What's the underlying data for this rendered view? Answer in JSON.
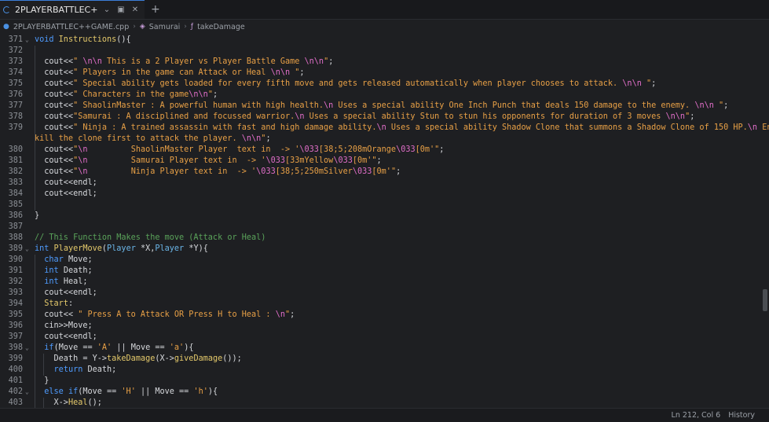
{
  "tab": {
    "title": "2PLAYERBATTLEC++GAM…"
  },
  "breadcrumb": {
    "file": "2PLAYERBATTLEC++GAME.cpp",
    "class": "Samurai",
    "method": "takeDamage"
  },
  "status": {
    "position": "Ln 212, Col 6",
    "history": "History"
  },
  "lines": [
    {
      "n": "371",
      "fold": true,
      "segs": [
        [
          "kw",
          "void "
        ],
        [
          "fn",
          "Instructions"
        ],
        [
          "pl",
          "(){"
        ]
      ]
    },
    {
      "n": "372",
      "segs": []
    },
    {
      "n": "373",
      "segs": [
        [
          "pl",
          "  cout<<"
        ],
        [
          "str",
          "\" "
        ],
        [
          "esc",
          "\\n\\n"
        ],
        [
          "str",
          " This is a 2 Player vs Player Battle Game "
        ],
        [
          "esc",
          "\\n\\n"
        ],
        [
          "str",
          "\""
        ],
        [
          "pl",
          ";"
        ]
      ]
    },
    {
      "n": "374",
      "segs": [
        [
          "pl",
          "  cout<<"
        ],
        [
          "str",
          "\" Players in the game can Attack or Heal "
        ],
        [
          "esc",
          "\\n\\n"
        ],
        [
          "str",
          " \""
        ],
        [
          "pl",
          ";"
        ]
      ]
    },
    {
      "n": "375",
      "segs": [
        [
          "pl",
          "  cout<<"
        ],
        [
          "str",
          "\" Special ability gets loaded for every fifth move and gets released automatically when player chooses to attack. "
        ],
        [
          "esc",
          "\\n\\n"
        ],
        [
          "str",
          " \""
        ],
        [
          "pl",
          ";"
        ]
      ]
    },
    {
      "n": "376",
      "segs": [
        [
          "pl",
          "  cout<<"
        ],
        [
          "str",
          "\" Characters in the game"
        ],
        [
          "esc",
          "\\n\\n"
        ],
        [
          "str",
          "\""
        ],
        [
          "pl",
          ";"
        ]
      ]
    },
    {
      "n": "377",
      "segs": [
        [
          "pl",
          "  cout<<"
        ],
        [
          "str",
          "\" ShaolinMaster : A powerful human with high health."
        ],
        [
          "esc",
          "\\n"
        ],
        [
          "str",
          " Uses a special ability One Inch Punch that deals 150 damage to the enemy. "
        ],
        [
          "esc",
          "\\n\\n"
        ],
        [
          "str",
          " \""
        ],
        [
          "pl",
          ";"
        ]
      ]
    },
    {
      "n": "378",
      "segs": [
        [
          "pl",
          "  cout<<"
        ],
        [
          "str",
          "\"Samurai : A disciplined and focussed warrior."
        ],
        [
          "esc",
          "\\n"
        ],
        [
          "str",
          " Uses a special ability Stun to stun his opponents for duration of 3 moves "
        ],
        [
          "esc",
          "\\n\\n"
        ],
        [
          "str",
          "\""
        ],
        [
          "pl",
          ";"
        ]
      ]
    },
    {
      "n": "379",
      "segs": [
        [
          "pl",
          "  cout<<"
        ],
        [
          "str",
          "\" Ninja : A trained assassin with fast and high damage ability."
        ],
        [
          "esc",
          "\\n"
        ],
        [
          "str",
          " Uses a special ability Shadow Clone that summons a Shadow Clone of 150 HP."
        ],
        [
          "esc",
          "\\n"
        ],
        [
          "str",
          " Enemy must"
        ]
      ]
    },
    {
      "n": "",
      "segs": [
        [
          "str",
          "kill the clone first to attack the player. "
        ],
        [
          "esc",
          "\\n\\n"
        ],
        [
          "str",
          "\""
        ],
        [
          "pl",
          ";"
        ]
      ],
      "wrap": true
    },
    {
      "n": "380",
      "segs": [
        [
          "pl",
          "  cout<<"
        ],
        [
          "str",
          "\""
        ],
        [
          "esc",
          "\\n"
        ],
        [
          "str",
          "         ShaolinMaster Player  text in  -> '"
        ],
        [
          "esc",
          "\\033"
        ],
        [
          "str",
          "[38;5;208mOrange"
        ],
        [
          "esc",
          "\\033"
        ],
        [
          "str",
          "[0m'\""
        ],
        [
          "pl",
          ";"
        ]
      ]
    },
    {
      "n": "381",
      "segs": [
        [
          "pl",
          "  cout<<"
        ],
        [
          "str",
          "\""
        ],
        [
          "esc",
          "\\n"
        ],
        [
          "str",
          "         Samurai Player text in  -> '"
        ],
        [
          "esc",
          "\\033"
        ],
        [
          "str",
          "[33mYellow"
        ],
        [
          "esc",
          "\\033"
        ],
        [
          "str",
          "[0m'\""
        ],
        [
          "pl",
          ";"
        ]
      ]
    },
    {
      "n": "382",
      "segs": [
        [
          "pl",
          "  cout<<"
        ],
        [
          "str",
          "\""
        ],
        [
          "esc",
          "\\n"
        ],
        [
          "str",
          "         Ninja Player text in  -> '"
        ],
        [
          "esc",
          "\\033"
        ],
        [
          "str",
          "[38;5;250mSilver"
        ],
        [
          "esc",
          "\\033"
        ],
        [
          "str",
          "[0m'\""
        ],
        [
          "pl",
          ";"
        ]
      ]
    },
    {
      "n": "383",
      "segs": [
        [
          "pl",
          "  cout<<endl;"
        ]
      ]
    },
    {
      "n": "384",
      "segs": [
        [
          "pl",
          "  cout<<endl;"
        ]
      ]
    },
    {
      "n": "385",
      "segs": []
    },
    {
      "n": "386",
      "segs": [
        [
          "pl",
          "}"
        ]
      ],
      "noguide": true
    },
    {
      "n": "387",
      "segs": [],
      "noguide": true
    },
    {
      "n": "388",
      "segs": [
        [
          "com",
          "// This Function Makes the move (Attack or Heal)"
        ]
      ],
      "noguide": true
    },
    {
      "n": "389",
      "fold": true,
      "segs": [
        [
          "kw",
          "int "
        ],
        [
          "fn",
          "PlayerMove"
        ],
        [
          "pl",
          "("
        ],
        [
          "ty",
          "Player"
        ],
        [
          "pl",
          " *X,"
        ],
        [
          "ty",
          "Player"
        ],
        [
          "pl",
          " *Y){"
        ]
      ],
      "noguide": true
    },
    {
      "n": "390",
      "segs": [
        [
          "pl",
          "  "
        ],
        [
          "kw",
          "char"
        ],
        [
          "pl",
          " Move;"
        ]
      ]
    },
    {
      "n": "391",
      "segs": [
        [
          "pl",
          "  "
        ],
        [
          "kw",
          "int"
        ],
        [
          "pl",
          " Death;"
        ]
      ]
    },
    {
      "n": "392",
      "segs": [
        [
          "pl",
          "  "
        ],
        [
          "kw",
          "int"
        ],
        [
          "pl",
          " Heal;"
        ]
      ]
    },
    {
      "n": "393",
      "segs": [
        [
          "pl",
          "  cout<<endl;"
        ]
      ]
    },
    {
      "n": "394",
      "segs": [
        [
          "pl",
          "  "
        ],
        [
          "fn",
          "Start"
        ],
        [
          "pl",
          ":"
        ]
      ]
    },
    {
      "n": "395",
      "segs": [
        [
          "pl",
          "  cout<< "
        ],
        [
          "str",
          "\" Press A to Attack OR Press H to Heal : "
        ],
        [
          "esc",
          "\\n"
        ],
        [
          "str",
          "\""
        ],
        [
          "pl",
          ";"
        ]
      ]
    },
    {
      "n": "396",
      "segs": [
        [
          "pl",
          "  cin>>Move;"
        ]
      ]
    },
    {
      "n": "397",
      "segs": [
        [
          "pl",
          "  cout<<endl;"
        ]
      ]
    },
    {
      "n": "398",
      "fold": true,
      "segs": [
        [
          "pl",
          "  "
        ],
        [
          "kw",
          "if"
        ],
        [
          "pl",
          "(Move == "
        ],
        [
          "ch",
          "'A'"
        ],
        [
          "pl",
          " || Move == "
        ],
        [
          "ch",
          "'a'"
        ],
        [
          "pl",
          "){"
        ]
      ]
    },
    {
      "n": "399",
      "segs": [
        [
          "pl",
          "    Death = Y->"
        ],
        [
          "fn",
          "takeDamage"
        ],
        [
          "pl",
          "(X->"
        ],
        [
          "fn",
          "giveDamage"
        ],
        [
          "pl",
          "());"
        ]
      ],
      "guide2": true
    },
    {
      "n": "400",
      "segs": [
        [
          "pl",
          "    "
        ],
        [
          "kw",
          "return"
        ],
        [
          "pl",
          " Death;"
        ]
      ],
      "guide2": true
    },
    {
      "n": "401",
      "segs": [
        [
          "pl",
          "  }"
        ]
      ]
    },
    {
      "n": "402",
      "fold": true,
      "segs": [
        [
          "pl",
          "  "
        ],
        [
          "kw",
          "else if"
        ],
        [
          "pl",
          "(Move == "
        ],
        [
          "ch",
          "'H'"
        ],
        [
          "pl",
          " || Move == "
        ],
        [
          "ch",
          "'h'"
        ],
        [
          "pl",
          "){"
        ]
      ]
    },
    {
      "n": "403",
      "segs": [
        [
          "pl",
          "    X->"
        ],
        [
          "fn",
          "Heal"
        ],
        [
          "pl",
          "();"
        ]
      ],
      "guide2": true
    }
  ]
}
